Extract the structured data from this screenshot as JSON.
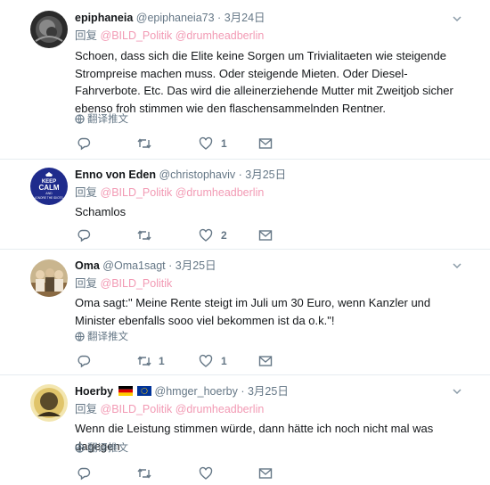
{
  "tweets": [
    {
      "name": "epiphaneia",
      "handle": "@epiphaneia73",
      "dot": "·",
      "date": "3月24日",
      "reply_label": "回复",
      "mentions": "@BILD_Politik @drumheadberlin",
      "text": "Schoen, dass sich die Elite keine Sorgen um Trivialitaeten wie steigende Strompreise machen muss. Oder steigende Mieten. Oder Diesel-Fahrverbote. Etc. Das wird die alleinerziehende Mutter mit Zweitjob sicher ebenso froh stimmen wie den flaschensammelnden Rentner.",
      "translate": "翻译推文",
      "retweets": "",
      "likes": "1"
    },
    {
      "name": "Enno von Eden",
      "handle": "@christophaviv",
      "dot": "·",
      "date": "3月25日",
      "reply_label": "回复",
      "mentions": "@BILD_Politik @drumheadberlin",
      "text": "Schamlos",
      "translate": "",
      "retweets": "",
      "likes": "2",
      "avatar_text_top": "KEEP",
      "avatar_text_mid": "CALM",
      "avatar_text_small": "AND",
      "avatar_text_bottom": "IGNORE THE IDIOTS"
    },
    {
      "name": "Oma",
      "handle": "@Oma1sagt",
      "dot": "·",
      "date": "3月25日",
      "reply_label": "回复",
      "mentions": "@BILD_Politik",
      "text": "Oma sagt:\" Meine Rente steigt im Juli um 30 Euro, wenn Kanzler und Minister ebenfalls sooo viel bekommen ist da o.k.\"!",
      "translate": "翻译推文",
      "retweets": "1",
      "likes": "1"
    },
    {
      "name": "Hoerby",
      "handle": "@hmger_hoerby",
      "dot": "·",
      "date": "3月25日",
      "reply_label": "回复",
      "mentions": "@BILD_Politik @drumheadberlin",
      "text": "Wenn die Leistung stimmen würde, dann hätte ich noch nicht mal was dagegen",
      "translate": "翻译推文",
      "retweets": "",
      "likes": ""
    }
  ],
  "colors": {
    "name": "#14171a",
    "secondary": "#657786",
    "mention": "#f29ab4",
    "divider": "#e6ecf0"
  },
  "icons": [
    "globe-icon",
    "reply-icon",
    "retweet-icon",
    "like-icon",
    "message-icon",
    "chevron-down-icon",
    "germany-flag-icon",
    "eu-flag-icon"
  ]
}
